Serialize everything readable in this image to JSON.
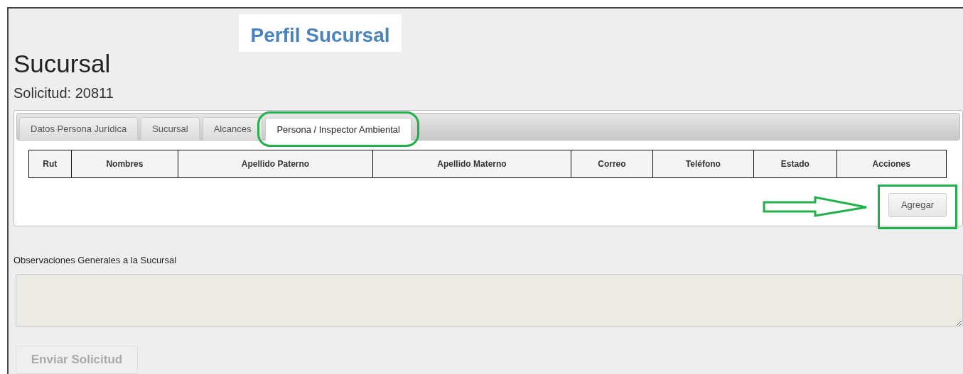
{
  "banner": {
    "title": "Perfil Sucursal"
  },
  "heading": "Sucursal",
  "request": "Solicitud: 20811",
  "tabs": [
    {
      "label": "Datos Persona Jurídica",
      "selected": false
    },
    {
      "label": "Sucursal",
      "selected": false
    },
    {
      "label": "Alcances",
      "selected": false
    },
    {
      "label": "Persona / Inspector Ambiental",
      "selected": true
    }
  ],
  "table": {
    "columns": [
      "Rut",
      "Nombres",
      "Apellido Paterno",
      "Apellido Materno",
      "Correo",
      "Teléfono",
      "Estado",
      "Acciones"
    ]
  },
  "add_button": {
    "label": "Agregar"
  },
  "observations": {
    "label": "Observaciones Generales a la Sucursal"
  },
  "submit_button": {
    "label": "Enviar Solicitud",
    "disabled": true
  }
}
